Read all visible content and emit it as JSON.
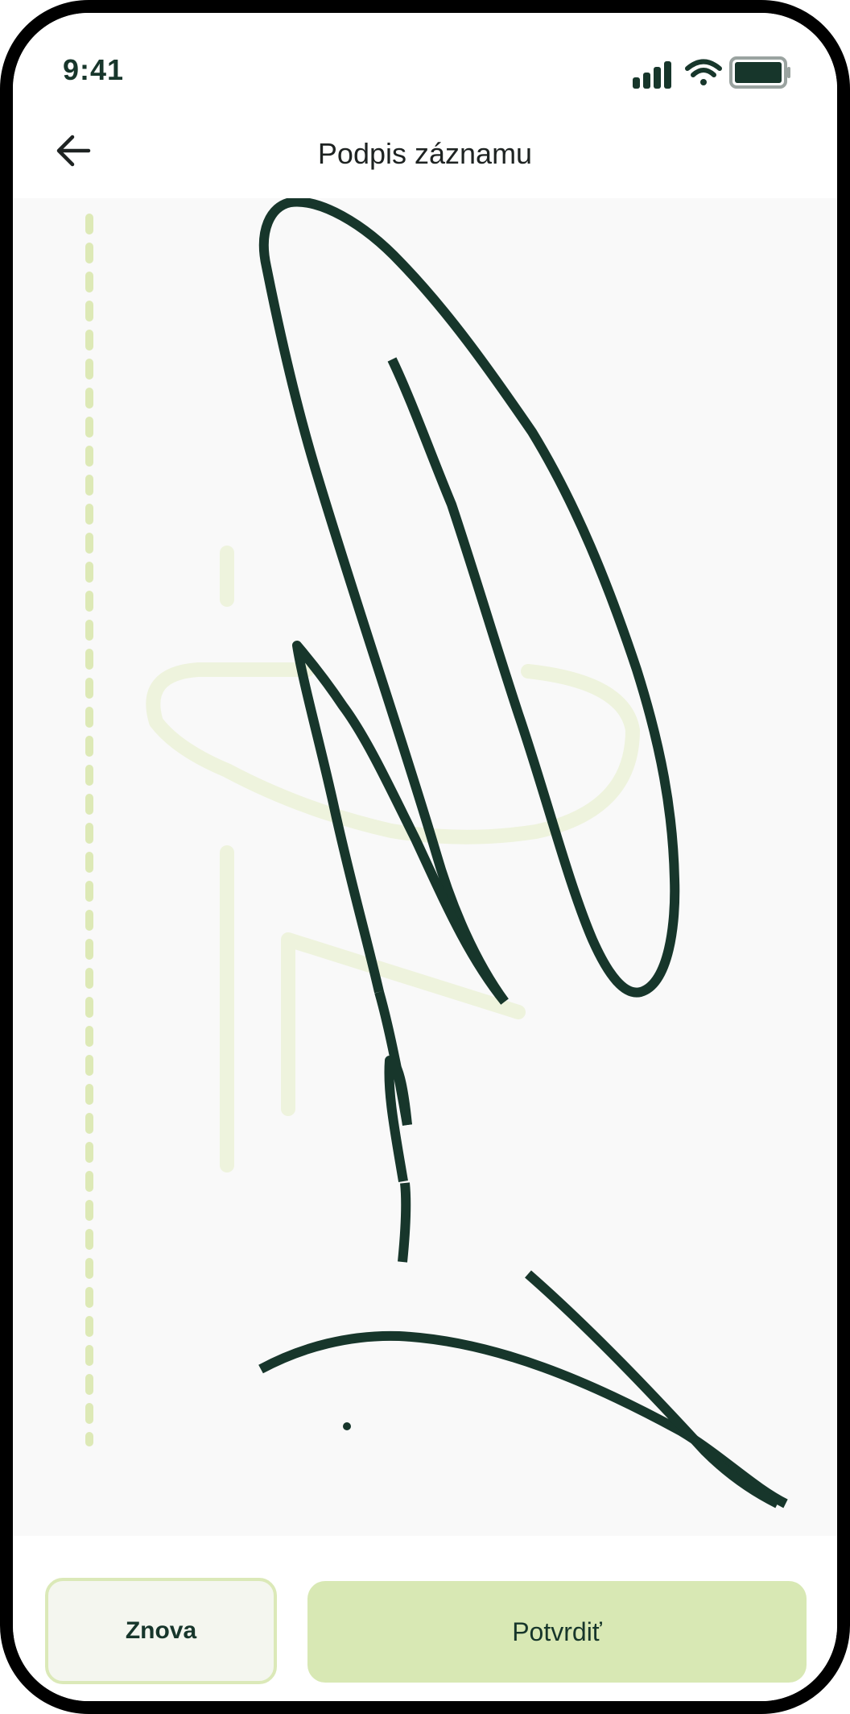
{
  "status_bar": {
    "time": "9:41",
    "icons": [
      "signal-icon",
      "wifi-icon",
      "battery-icon"
    ]
  },
  "header": {
    "title": "Podpis záznamu",
    "back_icon": "arrow-left-icon"
  },
  "actions": {
    "retry_label": "Znova",
    "confirm_label": "Potvrdiť"
  },
  "colors": {
    "ink": "#17362b",
    "accent": "#d8e8b4",
    "guide": "#dde9b6",
    "canvas": "#f9f9f9"
  }
}
